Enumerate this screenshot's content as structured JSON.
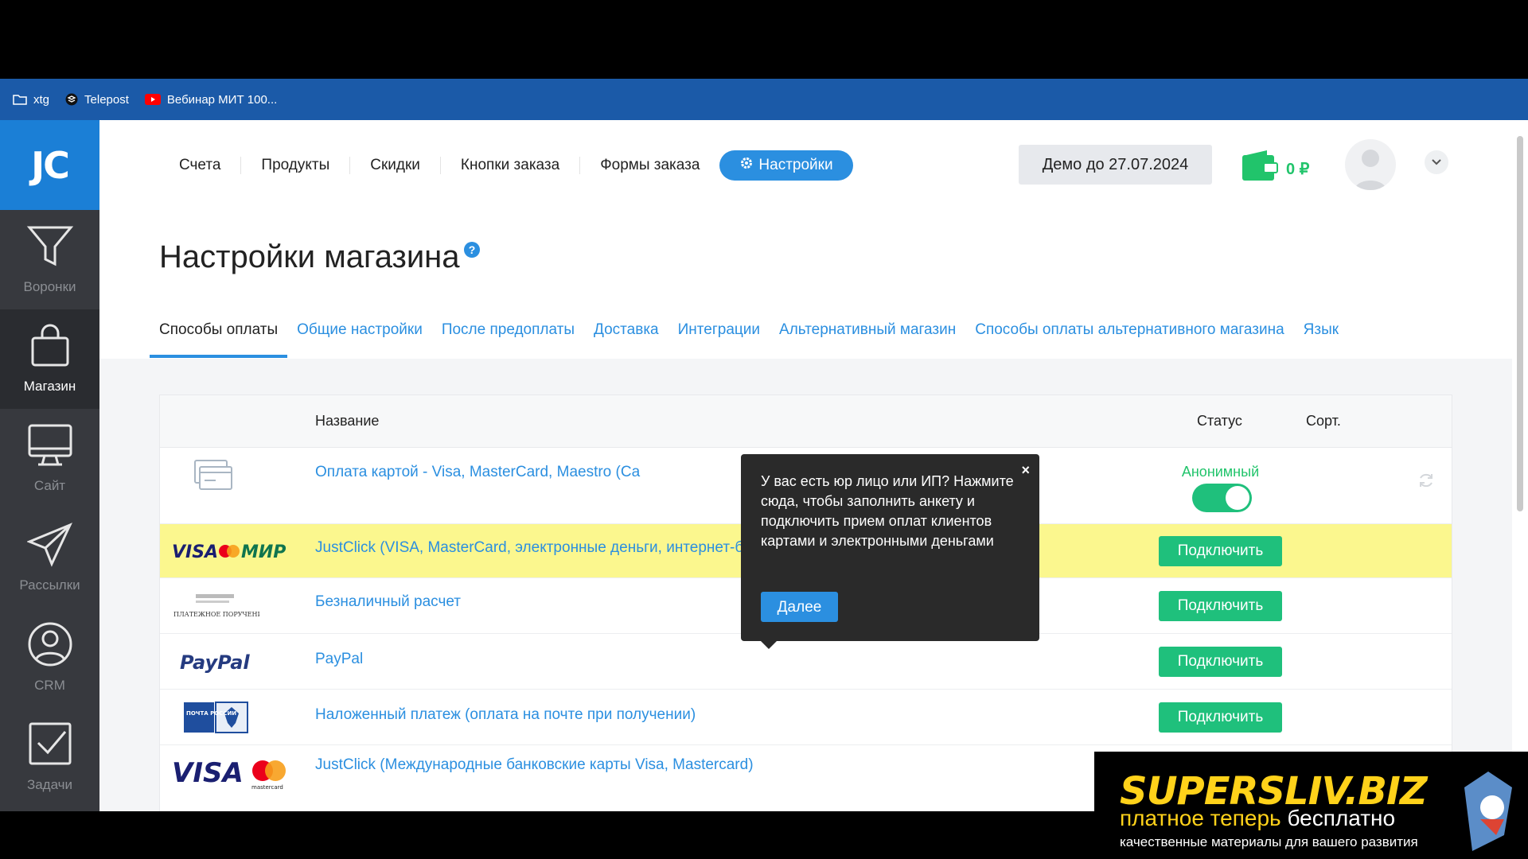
{
  "bookmarks": [
    {
      "label": "xtg",
      "icon": "folder-icon"
    },
    {
      "label": "Telepost",
      "icon": "telepost-icon"
    },
    {
      "label": "Вебинар МИТ 100...",
      "icon": "youtube-icon"
    }
  ],
  "sidebar": {
    "logo": "JC",
    "items": [
      {
        "label": "Воронки",
        "icon": "funnel-icon"
      },
      {
        "label": "Магазин",
        "icon": "bag-icon",
        "active": true
      },
      {
        "label": "Сайт",
        "icon": "monitor-icon"
      },
      {
        "label": "Рассылки",
        "icon": "paper-plane-icon"
      },
      {
        "label": "CRM",
        "icon": "user-circle-icon"
      },
      {
        "label": "Задачи",
        "icon": "checkbox-icon"
      }
    ]
  },
  "topnav": {
    "links": [
      "Счета",
      "Продукты",
      "Скидки",
      "Кнопки заказа",
      "Формы заказа"
    ],
    "settings_label": "Настройки",
    "demo_label": "Демо до 27.07.2024",
    "balance": "0 ₽"
  },
  "page": {
    "title": "Настройки магазина",
    "help": "?"
  },
  "tabs": [
    "Способы оплаты",
    "Общие настройки",
    "После предоплаты",
    "Доставка",
    "Интеграции",
    "Альтернативный магазин",
    "Способы оплаты альтернативного магазина",
    "Язык"
  ],
  "table": {
    "headers": {
      "name": "Название",
      "status": "Статус",
      "sort": "Сорт."
    },
    "rows": [
      {
        "name": "Оплата картой - Visa, MasterCard, Maestro (Ca",
        "status": "Анонимный",
        "toggle": "on",
        "logo": "card-icon"
      },
      {
        "name": "JustClick (VISA, MasterCard, электронные деньги, интернет-банкинг, терминалы, оплата в кредит)",
        "button": "Подключить",
        "logo": "visa-mir-logo",
        "highlight": true
      },
      {
        "name": "Безналичный расчет",
        "button": "Подключить",
        "logo": "payment-order-logo"
      },
      {
        "name": "PayPal",
        "button": "Подключить",
        "logo": "paypal-logo"
      },
      {
        "name": "Наложенный платеж (оплата на почте при получении)",
        "button": "Подключить",
        "logo": "russian-post-logo"
      },
      {
        "name": "JustClick (Международные банковские карты Visa, Mastercard)",
        "logo": "visa-mastercard-logo"
      }
    ]
  },
  "logos": {
    "visa": "VISA",
    "mir": "МИР",
    "paypal": "PayPal",
    "post": "ПОЧТА РОССИИ",
    "payment_order": "ПЛАТЕЖНОЕ ПОРУЧЕНИЕ",
    "mastercard": "mastercard"
  },
  "popover": {
    "text": "У вас есть юр лицо или ИП? Нажмите сюда, чтобы заполнить анкету и подключить прием оплат клиентов картами и электронными деньгами",
    "close": "×",
    "next_label": "Далее"
  },
  "banner": {
    "brand": "SUPERSLIV.BIZ",
    "tagline_a": "платное теперь",
    "tagline_b": "бесплатно",
    "subtitle": "качественные материалы для вашего развития"
  },
  "colors": {
    "accent": "#2b8fe0",
    "green": "#1fc07c",
    "highlight": "#fbf78e",
    "sidebar": "#37393e"
  }
}
